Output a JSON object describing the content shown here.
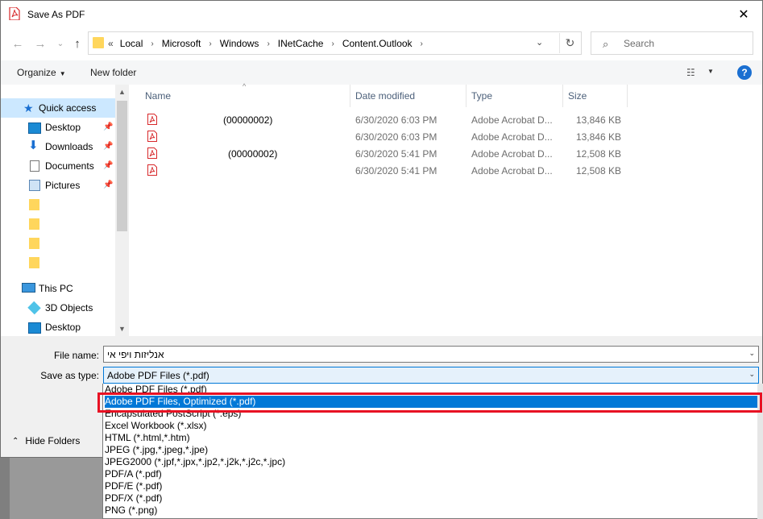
{
  "window": {
    "title": "Save As PDF",
    "close_glyph": "✕"
  },
  "address": {
    "prefix": "«",
    "crumbs": [
      "Local",
      "Microsoft",
      "Windows",
      "INetCache",
      "Content.Outlook"
    ]
  },
  "search": {
    "placeholder": "Search"
  },
  "toolbar": {
    "organize": "Organize",
    "new_folder": "New folder",
    "help": "?"
  },
  "navpane": {
    "quick_access": "Quick access",
    "pinned": [
      {
        "label": "Desktop",
        "icon": "desktop-icon"
      },
      {
        "label": "Downloads",
        "icon": "downloads-icon"
      },
      {
        "label": "Documents",
        "icon": "documents-icon"
      },
      {
        "label": "Pictures",
        "icon": "pictures-icon"
      }
    ],
    "this_pc": "This PC",
    "pc_items": [
      {
        "label": "3D Objects",
        "icon": "3d-objects-icon"
      },
      {
        "label": "Desktop",
        "icon": "desktop-icon"
      }
    ]
  },
  "columns": {
    "name": "Name",
    "date": "Date modified",
    "type": "Type",
    "size": "Size"
  },
  "files": [
    {
      "name": "(00000002)",
      "date": "6/30/2020 6:03 PM",
      "type": "Adobe Acrobat D...",
      "size": "13,846 KB"
    },
    {
      "name": "",
      "date": "6/30/2020 6:03 PM",
      "type": "Adobe Acrobat D...",
      "size": "13,846 KB"
    },
    {
      "name": "(00000002)",
      "date": "6/30/2020 5:41 PM",
      "type": "Adobe Acrobat D...",
      "size": "12,508 KB"
    },
    {
      "name": "",
      "date": "6/30/2020 5:41 PM",
      "type": "Adobe Acrobat D...",
      "size": "12,508 KB"
    }
  ],
  "fields": {
    "file_name_label": "File name:",
    "file_name_value": "אנליזות ויפי אי",
    "save_type_label": "Save as type:",
    "save_type_value": "Adobe PDF Files (*.pdf)"
  },
  "hide_folders": "Hide Folders",
  "type_options": [
    "Adobe PDF Files (*.pdf)",
    "Adobe PDF Files, Optimized (*.pdf)",
    "Encapsulated PostScript (*.eps)",
    "Excel Workbook (*.xlsx)",
    "HTML (*.html,*.htm)",
    "JPEG (*.jpg,*.jpeg,*.jpe)",
    "JPEG2000 (*.jpf,*.jpx,*.jp2,*.j2k,*.j2c,*.jpc)",
    "PDF/A (*.pdf)",
    "PDF/E (*.pdf)",
    "PDF/X (*.pdf)",
    "PNG (*.png)"
  ],
  "selected_option": 1,
  "colors": {
    "accent": "#0078d7",
    "highlight_frame": "#e81123",
    "pdf_red": "#d7272a",
    "folder": "#ffd65c"
  }
}
